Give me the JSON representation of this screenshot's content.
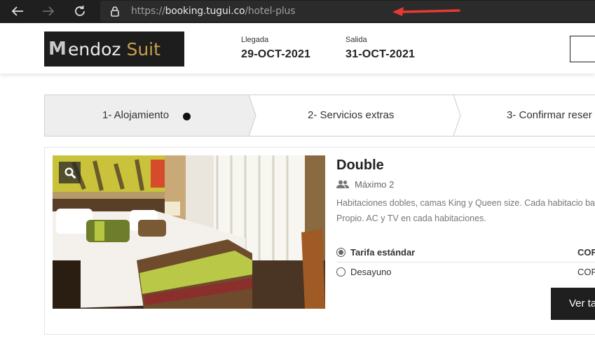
{
  "browser": {
    "url_scheme": "https://",
    "url_host": "booking.tugui.co",
    "url_path": "/hotel-plus"
  },
  "header": {
    "logo_letter": "M",
    "logo_word1": "endoz",
    "logo_word2": "Suit",
    "checkin_label": "Llegada",
    "checkin_value": "29-OCT-2021",
    "checkout_label": "Salida",
    "checkout_value": "31-OCT-2021"
  },
  "steps": [
    {
      "label": "1- Alojamiento",
      "active": true
    },
    {
      "label": "2- Servicios extras",
      "active": false
    },
    {
      "label": "3- Confirmar reser",
      "active": false
    }
  ],
  "room": {
    "title": "Double",
    "capacity": "Máximo 2",
    "description": "Habitaciones dobles, camas King y Queen size. Cada habitacio baño Propio. AC y TV en cada habitaciones.",
    "rates": [
      {
        "label": "Tarifa estándar",
        "price": "COF",
        "selected": true
      },
      {
        "label": "Desayuno",
        "price": "COF",
        "selected": false
      }
    ],
    "cta_label": "Ver ta"
  },
  "colors": {
    "browser_bg": "#1f1f1f",
    "accent_arrow": "#e53935",
    "logo_gold": "#c9a04a",
    "button_dark": "#1f1f1f"
  }
}
